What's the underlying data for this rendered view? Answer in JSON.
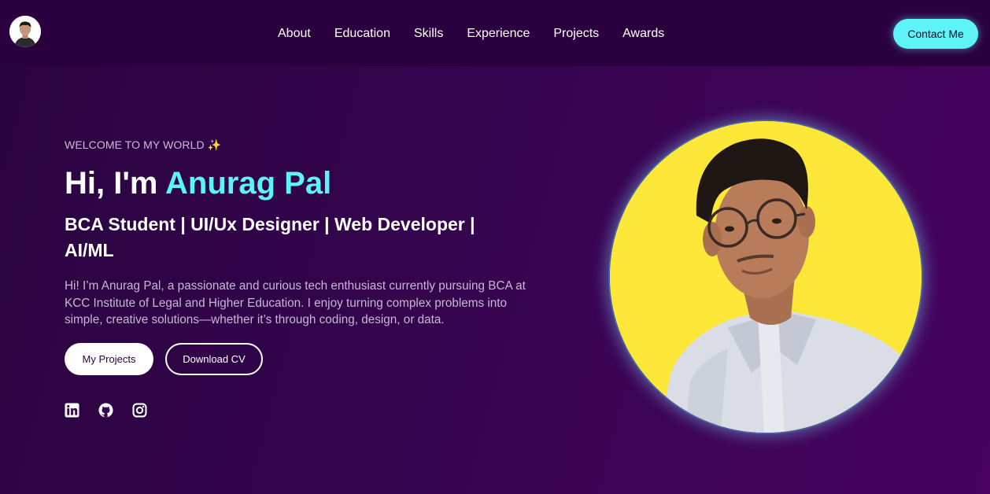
{
  "nav": {
    "items": [
      "About",
      "Education",
      "Skills",
      "Experience",
      "Projects",
      "Awards"
    ],
    "contact_label": "Contact Me"
  },
  "hero": {
    "welcome": "WELCOME TO MY WORLD ✨",
    "greeting": "Hi, I'm ",
    "name": "Anurag Pal",
    "subtitle": "BCA Student | UI/Ux Designer | Web Developer | AI/ML",
    "bio": "Hi! I’m Anurag Pal, a passionate and curious tech enthusiast currently pursuing BCA at KCC Institute of Legal and Higher Education. I enjoy turning complex problems into simple, creative solutions—whether it’s through coding, design, or data.",
    "primary_button": "My Projects",
    "secondary_button": "Download CV"
  },
  "social": [
    "linkedin-icon",
    "github-icon",
    "instagram-icon"
  ],
  "colors": {
    "header_bg": "#2b003f",
    "accent": "#5ef3f6",
    "portrait_bg": "#fde83a"
  }
}
